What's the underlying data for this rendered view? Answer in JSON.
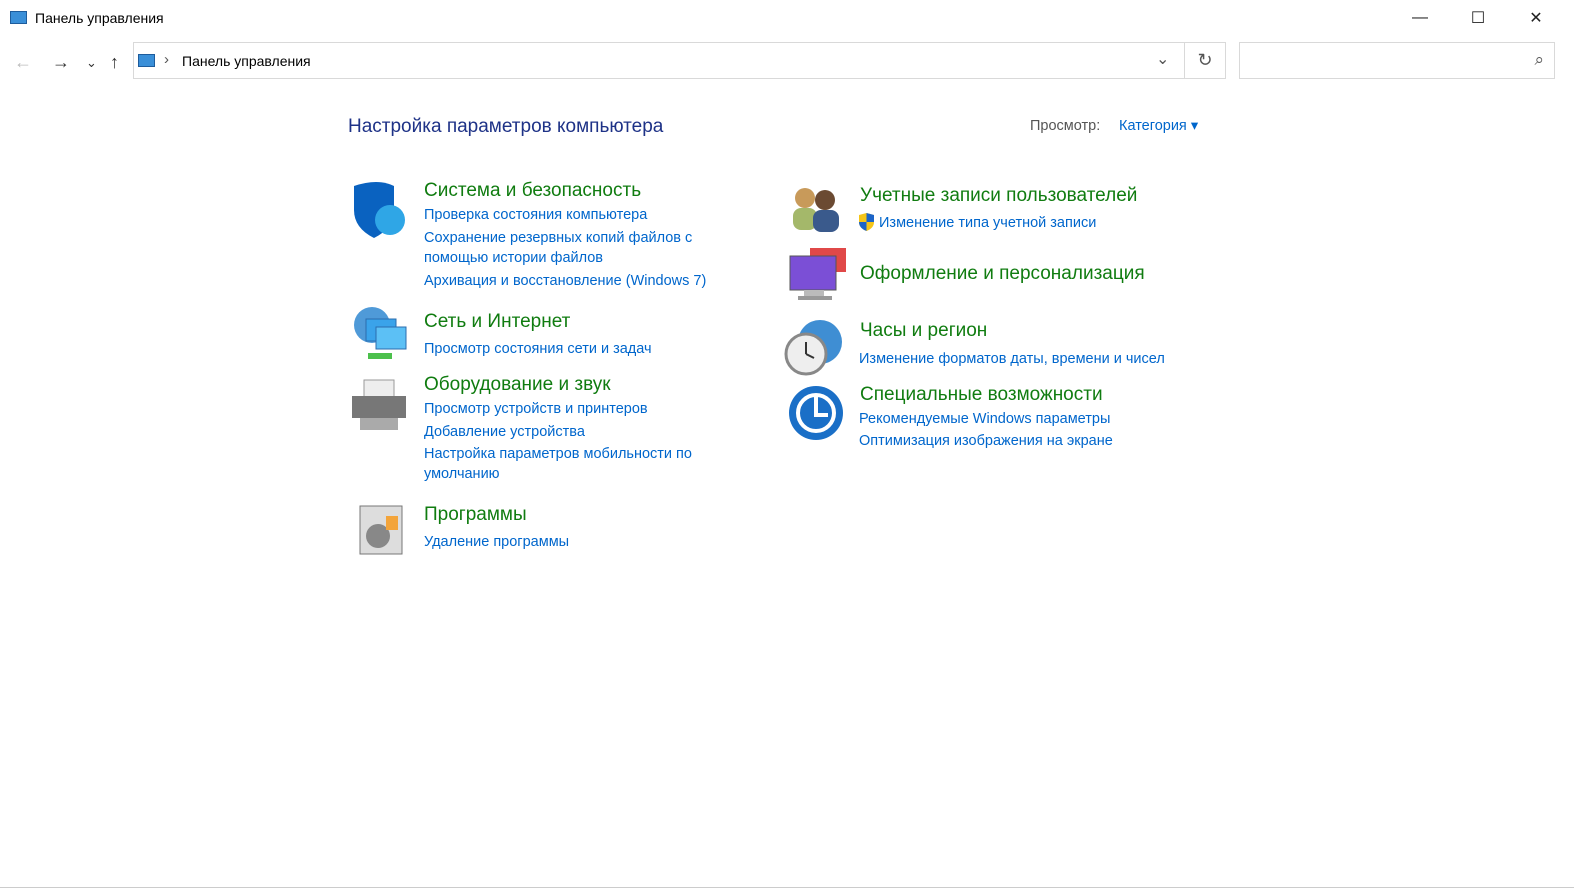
{
  "window": {
    "title": "Панель управления",
    "minimize": "—",
    "maximize": "☐",
    "close": "✕"
  },
  "nav": {
    "back": "←",
    "forward": "→",
    "recent": "⌄",
    "up": "↑"
  },
  "address": {
    "separator": "›",
    "path": "Панель управления",
    "dropdown": "⌄",
    "refresh": "↻"
  },
  "search": {
    "placeholder": "",
    "icon": "⌕"
  },
  "main": {
    "heading": "Настройка параметров компьютера",
    "view_label": "Просмотр:",
    "view_value": "Категория",
    "view_arrow": "▾"
  },
  "left": [
    {
      "title": "Система и безопасность",
      "links": [
        "Проверка состояния компьютера",
        "Сохранение резервных копий файлов с помощью истории файлов",
        "Архивация и восстановление (Windows 7)"
      ]
    },
    {
      "title": "Сеть и Интернет",
      "links": [
        "Просмотр состояния сети и задач"
      ]
    },
    {
      "title": "Оборудование и звук",
      "links": [
        "Просмотр устройств и принтеров",
        "Добавление устройства",
        "Настройка параметров мобильности по умолчанию"
      ]
    },
    {
      "title": "Программы",
      "links": [
        "Удаление программы"
      ]
    }
  ],
  "right": [
    {
      "title": "Учетные записи пользователей",
      "links": [
        "Изменение типа учетной записи"
      ]
    },
    {
      "title": "Оформление и персонализация",
      "links": []
    },
    {
      "title": "Часы и регион",
      "links": [
        "Изменение форматов даты, времени и чисел"
      ]
    },
    {
      "title": "Специальные возможности",
      "links": [
        "Рекомендуемые Windows параметры",
        "Оптимизация изображения на экране"
      ]
    }
  ]
}
